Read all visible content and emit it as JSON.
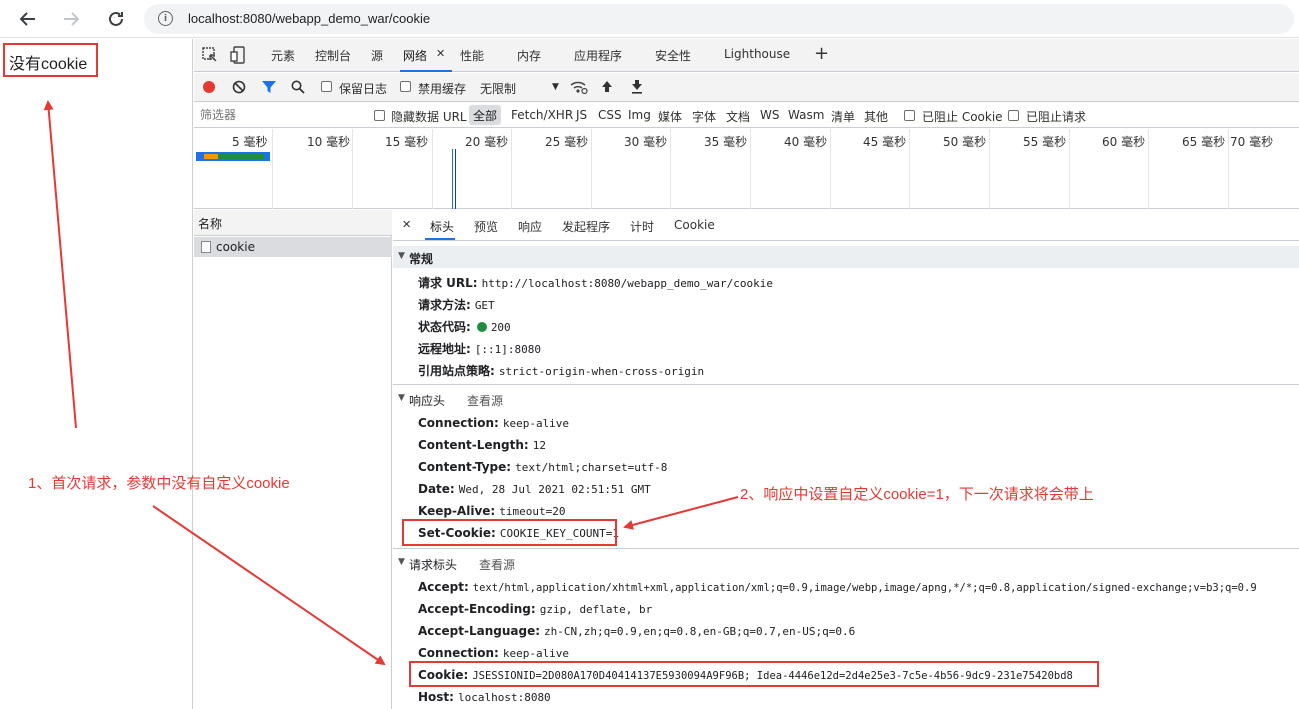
{
  "browser": {
    "url": "localhost:8080/webapp_demo_war/cookie"
  },
  "page": {
    "text": "没有cookie"
  },
  "devtools": {
    "tabs": [
      "元素",
      "控制台",
      "源",
      "网络",
      "性能",
      "内存",
      "应用程序",
      "安全性",
      "Lighthouse"
    ],
    "active_tab": "网络",
    "toolbar": {
      "preserve_log": "保留日志",
      "disable_cache": "禁用缓存",
      "throttle": "无限制"
    },
    "filter": {
      "placeholder": "筛选器",
      "hide_data_url": "隐藏数据 URL",
      "types": [
        "全部",
        "Fetch/XHR",
        "JS",
        "CSS",
        "Img",
        "媒体",
        "字体",
        "文档",
        "WS",
        "Wasm",
        "清单",
        "其他"
      ],
      "blocked_cookie": "已阻止 Cookie",
      "blocked_request": "已阻止请求"
    },
    "timeline_ticks": [
      "5 毫秒",
      "10 毫秒",
      "15 毫秒",
      "20 毫秒",
      "25 毫秒",
      "30 毫秒",
      "35 毫秒",
      "40 毫秒",
      "45 毫秒",
      "50 毫秒",
      "55 毫秒",
      "60 毫秒",
      "65 毫秒",
      "70 毫秒"
    ],
    "request_list": {
      "header": "名称",
      "items": [
        "cookie"
      ]
    },
    "detail_tabs": [
      "标头",
      "预览",
      "响应",
      "发起程序",
      "计时",
      "Cookie"
    ],
    "general": {
      "title": "常规",
      "rows": [
        {
          "k": "请求 URL:",
          "v": "http://localhost:8080/webapp_demo_war/cookie"
        },
        {
          "k": "请求方法:",
          "v": "GET"
        },
        {
          "k": "状态代码:",
          "v": "200"
        },
        {
          "k": "远程地址:",
          "v": "[::1]:8080"
        },
        {
          "k": "引用站点策略:",
          "v": "strict-origin-when-cross-origin"
        }
      ],
      "status_color": "#1e8e3e"
    },
    "response_headers": {
      "title": "响应头",
      "view_source": "查看源",
      "rows": [
        {
          "k": "Connection:",
          "v": "keep-alive"
        },
        {
          "k": "Content-Length:",
          "v": "12"
        },
        {
          "k": "Content-Type:",
          "v": "text/html;charset=utf-8"
        },
        {
          "k": "Date:",
          "v": "Wed, 28 Jul 2021 02:51:51 GMT"
        },
        {
          "k": "Keep-Alive:",
          "v": "timeout=20"
        },
        {
          "k": "Set-Cookie:",
          "v": "COOKIE_KEY_COUNT=1"
        }
      ]
    },
    "request_headers": {
      "title": "请求标头",
      "view_source": "查看源",
      "rows": [
        {
          "k": "Accept:",
          "v": "text/html,application/xhtml+xml,application/xml;q=0.9,image/webp,image/apng,*/*;q=0.8,application/signed-exchange;v=b3;q=0.9"
        },
        {
          "k": "Accept-Encoding:",
          "v": "gzip, deflate, br"
        },
        {
          "k": "Accept-Language:",
          "v": "zh-CN,zh;q=0.9,en;q=0.8,en-GB;q=0.7,en-US;q=0.6"
        },
        {
          "k": "Connection:",
          "v": "keep-alive"
        },
        {
          "k": "Cookie:",
          "v": "JSESSIONID=2D080A170D40414137E5930094A9F96B; Idea-4446e12d=2d4e25e3-7c5e-4b56-9dc9-231e75420bd8"
        },
        {
          "k": "Host:",
          "v": "localhost:8080"
        }
      ]
    }
  },
  "annotations": {
    "note1": "1、首次请求，参数中没有自定义cookie",
    "note2": "2、响应中设置自定义cookie=1，下一次请求将会带上",
    "color": "#e53935"
  }
}
